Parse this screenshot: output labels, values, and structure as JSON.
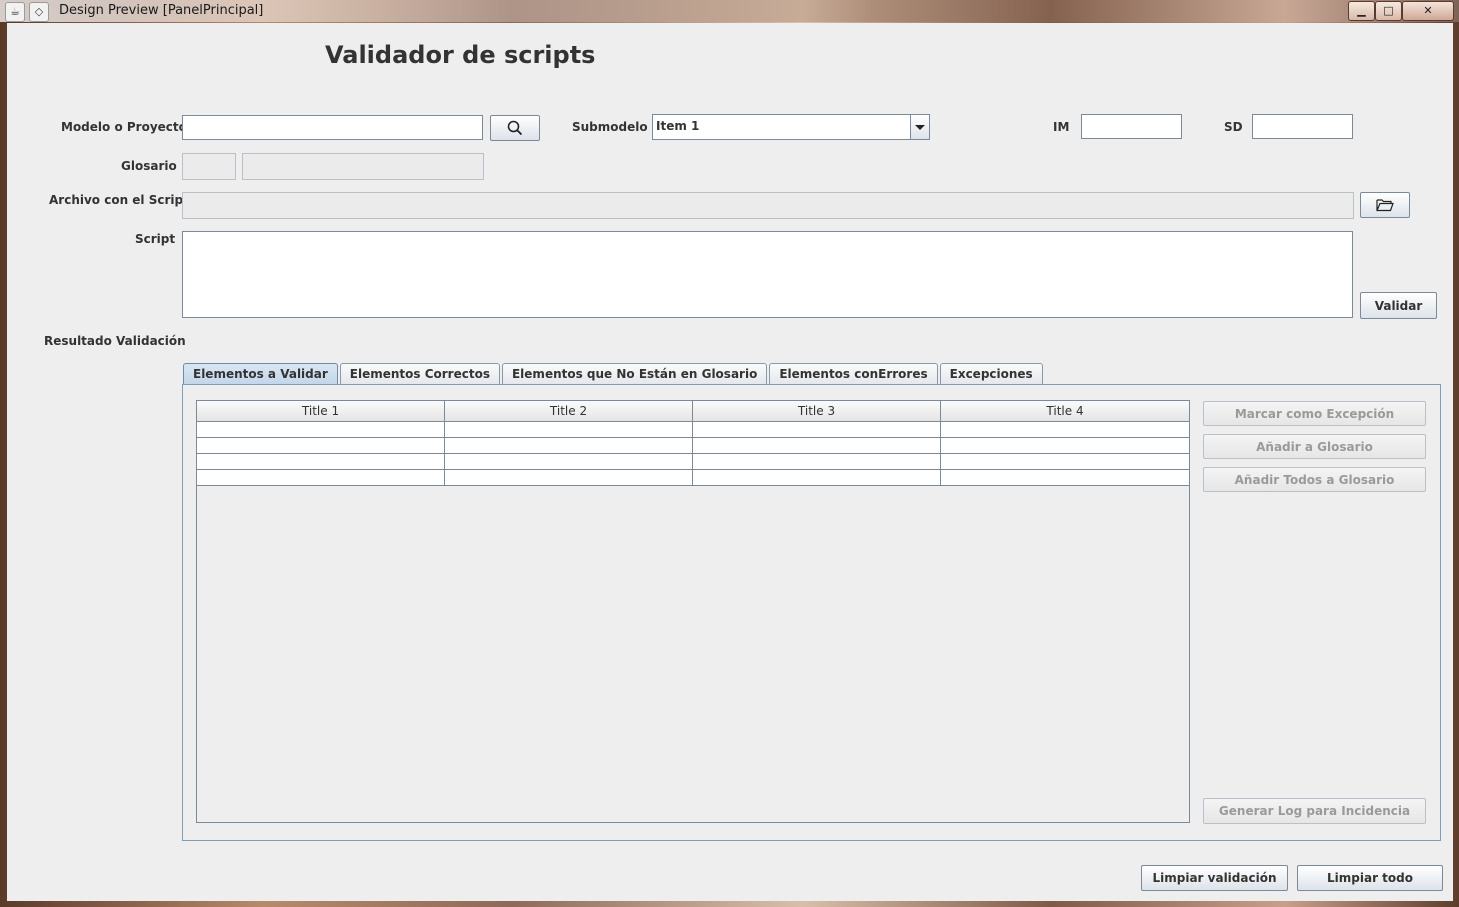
{
  "window": {
    "title": "Design Preview [PanelPrincipal]",
    "controls": {
      "minimize": "▁",
      "maximize": "□",
      "close": "✕"
    }
  },
  "heading": "Validador de scripts",
  "form": {
    "modelo_label": "Modelo o Proyecto",
    "modelo_value": "",
    "submodelo_label": "Submodelo",
    "submodelo_value": "Item 1",
    "im_label": "IM",
    "im_value": "",
    "sd_label": "SD",
    "sd_value": "",
    "glosario_label": "Glosario",
    "archivo_label": "Archivo con el Script",
    "script_label": "Script",
    "validar_button": "Validar",
    "resultado_label": "Resultado Validación"
  },
  "tabs": [
    "Elementos a Validar",
    "Elementos Correctos",
    "Elementos que No Están en Glosario",
    "Elementos conErrores",
    "Excepciones"
  ],
  "table": {
    "columns": [
      "Title 1",
      "Title 2",
      "Title 3",
      "Title 4"
    ],
    "rows": [
      [
        "",
        "",
        "",
        ""
      ],
      [
        "",
        "",
        "",
        ""
      ],
      [
        "",
        "",
        "",
        ""
      ],
      [
        "",
        "",
        "",
        ""
      ]
    ]
  },
  "side_buttons": {
    "marcar": "Marcar como Excepción",
    "anadir": "Añadir a Glosario",
    "anadir_todos": "Añadir Todos a Glosario",
    "generar_log": "Generar Log para Incidencia"
  },
  "footer": {
    "limpiar_validacion": "Limpiar validación",
    "limpiar_todo": "Limpiar todo"
  },
  "icons": {
    "app": "java-cup-icon",
    "window_menu": "diamond-icon",
    "search": "search-icon",
    "folder": "folder-open-icon"
  }
}
